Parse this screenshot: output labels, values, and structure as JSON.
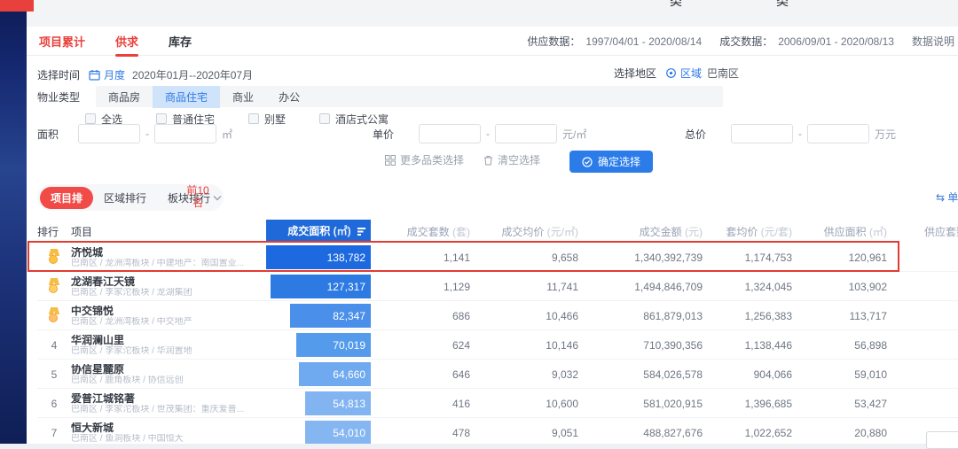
{
  "window": {
    "top_partial_labels": [
      "类",
      "类"
    ]
  },
  "header": {
    "tabs": [
      {
        "label": "项目累计",
        "style": "red",
        "active": false
      },
      {
        "label": "供求",
        "style": "red",
        "active": true
      },
      {
        "label": "库存",
        "style": "dark",
        "active": false
      }
    ],
    "meta": {
      "supply_label": "供应数据：",
      "supply_value": "1997/04/01 - 2020/08/14",
      "deal_label": "成交数据：",
      "deal_value": "2006/09/01 - 2020/08/13",
      "note": "数据说明"
    }
  },
  "filters": {
    "time": {
      "label": "选择时间",
      "mode": "月度",
      "range": "2020年01月--2020年07月"
    },
    "region": {
      "label": "选择地区",
      "type": "区域",
      "value": "巴南区"
    },
    "property": {
      "label": "物业类型",
      "options": [
        "商品房",
        "商品住宅",
        "商业",
        "办公"
      ],
      "selected": "商品住宅"
    },
    "subtypes": [
      "全选",
      "普通住宅",
      "别墅",
      "酒店式公寓"
    ],
    "area": {
      "label": "面积",
      "unit": "㎡"
    },
    "unit_price": {
      "label": "单价",
      "unit": "元/㎡"
    },
    "total_price": {
      "label": "总价",
      "unit": "万元"
    },
    "actions": {
      "more": "更多品类选择",
      "clear": "清空选择",
      "confirm": "确定选择"
    }
  },
  "ranking": {
    "tabs": [
      {
        "label": "项目排",
        "active": true
      },
      {
        "label": "区域排行",
        "active": false
      },
      {
        "label": "板块排行",
        "active": false
      }
    ],
    "top_n": "前10名",
    "unit_toggle_partial": "单"
  },
  "table": {
    "headers": {
      "rank": "排行",
      "project": "项目",
      "deal_area": {
        "label": "成交面积",
        "unit": "(㎡)"
      },
      "deal_count": {
        "label": "成交套数",
        "unit": "(套)"
      },
      "deal_avg": {
        "label": "成交均价",
        "unit": "(元/㎡)"
      },
      "deal_amount": {
        "label": "成交金额",
        "unit": "(元)"
      },
      "per_unit_avg": {
        "label": "套均价",
        "unit": "(元/套)"
      },
      "supply_area": {
        "label": "供应面积",
        "unit": "(㎡)"
      },
      "supply_count": {
        "label": "供应套数",
        "unit": ""
      }
    },
    "bar_colors": [
      "#1d6ae0",
      "#2e7ae3",
      "#4a8fe9",
      "#559bec",
      "#6fa9ef",
      "#82b4f1",
      "#85b6f1"
    ],
    "medal_colors": [
      "#ffc53d",
      "#ffd066",
      "#ffc069"
    ],
    "rows": [
      {
        "rank": "1",
        "medal": true,
        "highlighted": true,
        "name": "济悦城",
        "sub": "巴南区 / 龙洲湾板块 / 中建地产：南国置业...",
        "area": "138,782",
        "area_value": 138782,
        "count": "1,141",
        "avg": "9,658",
        "amount": "1,340,392,739",
        "per_unit_avg": "1,174,753",
        "supply_area": "120,961"
      },
      {
        "rank": "2",
        "medal": true,
        "highlighted": false,
        "name": "龙湖春江天镜",
        "sub": "巴南区 / 李家沱板块 / 龙湖集团",
        "area": "127,317",
        "area_value": 127317,
        "count": "1,129",
        "avg": "11,741",
        "amount": "1,494,846,709",
        "per_unit_avg": "1,324,045",
        "supply_area": "103,902"
      },
      {
        "rank": "3",
        "medal": true,
        "highlighted": false,
        "name": "中交锦悦",
        "sub": "巴南区 / 龙洲湾板块 / 中交地产",
        "area": "82,347",
        "area_value": 82347,
        "count": "686",
        "avg": "10,466",
        "amount": "861,879,013",
        "per_unit_avg": "1,256,383",
        "supply_area": "113,717"
      },
      {
        "rank": "4",
        "medal": false,
        "highlighted": false,
        "name": "华润澜山里",
        "sub": "巴南区 / 李家沱板块 / 华润置地",
        "area": "70,019",
        "area_value": 70019,
        "count": "624",
        "avg": "10,146",
        "amount": "710,390,356",
        "per_unit_avg": "1,138,446",
        "supply_area": "56,898"
      },
      {
        "rank": "5",
        "medal": false,
        "highlighted": false,
        "name": "协信星麓原",
        "sub": "巴南区 / 鹿角板块 / 协信远创",
        "area": "64,660",
        "area_value": 64660,
        "count": "646",
        "avg": "9,032",
        "amount": "584,026,578",
        "per_unit_avg": "904,066",
        "supply_area": "59,010"
      },
      {
        "rank": "6",
        "medal": false,
        "highlighted": false,
        "name": "爱普江城铭著",
        "sub": "巴南区 / 李家沱板块 / 世茂集团：重庆爱普...",
        "area": "54,813",
        "area_value": 54813,
        "count": "416",
        "avg": "10,600",
        "amount": "581,020,915",
        "per_unit_avg": "1,396,685",
        "supply_area": "53,427"
      },
      {
        "rank": "7",
        "medal": false,
        "highlighted": false,
        "name": "恒大新城",
        "sub": "巴南区 / 鱼洞板块 / 中国恒大",
        "area": "54,010",
        "area_value": 54010,
        "count": "478",
        "avg": "9,051",
        "amount": "488,827,676",
        "per_unit_avg": "1,022,652",
        "supply_area": "20,880"
      }
    ]
  }
}
